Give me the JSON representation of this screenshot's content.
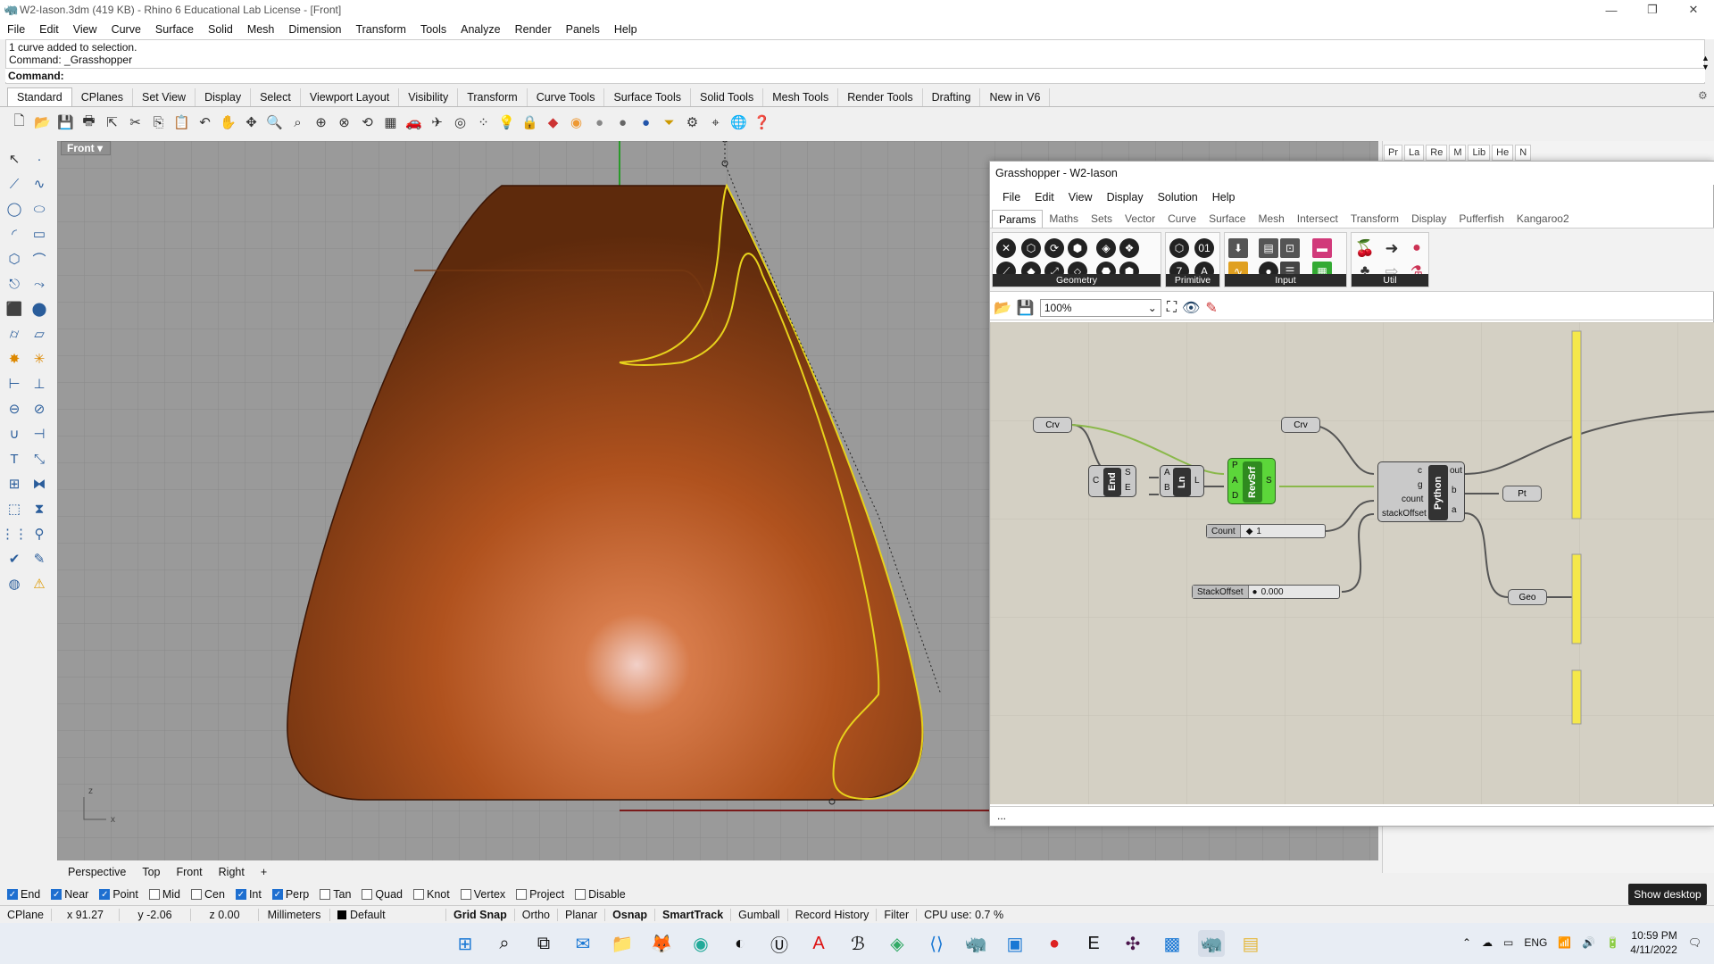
{
  "window": {
    "title": "W2-Iason.3dm (419 KB) - Rhino 6 Educational Lab License - [Front]"
  },
  "menu": [
    "File",
    "Edit",
    "View",
    "Curve",
    "Surface",
    "Solid",
    "Mesh",
    "Dimension",
    "Transform",
    "Tools",
    "Analyze",
    "Render",
    "Panels",
    "Help"
  ],
  "command": {
    "line1": "1 curve added to selection.",
    "line2": "Command: _Grasshopper",
    "prompt": "Command:"
  },
  "toolbar_tabs": [
    "Standard",
    "CPlanes",
    "Set View",
    "Display",
    "Select",
    "Viewport Layout",
    "Visibility",
    "Transform",
    "Curve Tools",
    "Surface Tools",
    "Solid Tools",
    "Mesh Tools",
    "Render Tools",
    "Drafting",
    "New in V6"
  ],
  "viewport": {
    "name": "Front",
    "axis_z": "z",
    "axis_x": "x"
  },
  "viewport_tabs": [
    "Perspective",
    "Top",
    "Front",
    "Right",
    "+"
  ],
  "osnaps": [
    {
      "label": "End",
      "on": true
    },
    {
      "label": "Near",
      "on": true
    },
    {
      "label": "Point",
      "on": true
    },
    {
      "label": "Mid",
      "on": false
    },
    {
      "label": "Cen",
      "on": false
    },
    {
      "label": "Int",
      "on": true
    },
    {
      "label": "Perp",
      "on": true
    },
    {
      "label": "Tan",
      "on": false
    },
    {
      "label": "Quad",
      "on": false
    },
    {
      "label": "Knot",
      "on": false
    },
    {
      "label": "Vertex",
      "on": false
    },
    {
      "label": "Project",
      "on": false
    },
    {
      "label": "Disable",
      "on": false
    }
  ],
  "status": {
    "cplane": "CPlane",
    "x": "x 91.27",
    "y": "y -2.06",
    "z": "z 0.00",
    "units": "Millimeters",
    "layer": "Default",
    "grid_snap": "Grid Snap",
    "ortho": "Ortho",
    "planar": "Planar",
    "osnap": "Osnap",
    "smarttrack": "SmartTrack",
    "gumball": "Gumball",
    "record": "Record History",
    "filter": "Filter",
    "cpu": "CPU use: 0.7 %"
  },
  "right_panel_tabs": [
    "Pr",
    "La",
    "Re",
    "M",
    "Lib",
    "He",
    "N"
  ],
  "grasshopper": {
    "title": "Grasshopper - W2-Iason",
    "menu": [
      "File",
      "Edit",
      "View",
      "Display",
      "Solution",
      "Help"
    ],
    "tabs": [
      "Params",
      "Maths",
      "Sets",
      "Vector",
      "Curve",
      "Surface",
      "Mesh",
      "Intersect",
      "Transform",
      "Display",
      "Pufferfish",
      "Kangaroo2"
    ],
    "groups": [
      "Geometry",
      "Primitive",
      "Input",
      "Util"
    ],
    "zoom": "100%",
    "nodes": {
      "crv1": "Crv",
      "crv2": "Crv",
      "end": "End",
      "ln": "Ln",
      "revsrf": "RevSrf",
      "python": "Python",
      "pt": "Pt",
      "geo": "Geo",
      "count_label": "Count",
      "count_value": "1",
      "stack_label": "StackOffset",
      "stack_value": "0.000",
      "end_in": "C",
      "end_out1": "S",
      "end_out2": "E",
      "ln_in1": "A",
      "ln_in2": "B",
      "ln_out": "L",
      "rev_in1": "P",
      "rev_in2": "A",
      "rev_in3": "D",
      "rev_out": "S",
      "py_in1": "c",
      "py_in2": "g",
      "py_in3": "count",
      "py_in4": "stackOffset",
      "py_out1": "out",
      "py_out2": "b",
      "py_out3": "a"
    },
    "status": "..."
  },
  "taskbar": {
    "lang": "ENG",
    "time": "10:59 PM",
    "date": "4/11/2022"
  },
  "show_desktop": "Show desktop"
}
